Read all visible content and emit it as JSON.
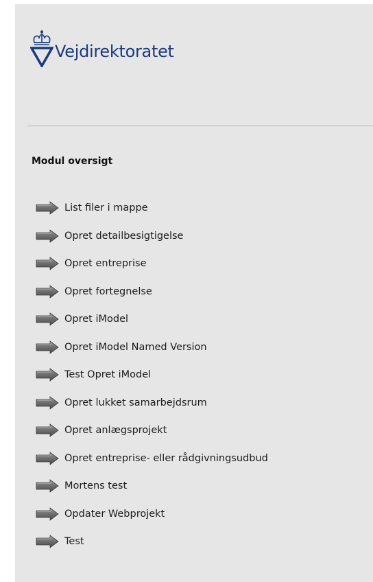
{
  "header": {
    "logo_text": "Vejdirektoratet",
    "logo_icon": "crown-triangle-logo"
  },
  "section": {
    "title": "Modul oversigt"
  },
  "menu": {
    "icon": "arrow-right-icon",
    "items": [
      {
        "label": "List filer i mappe"
      },
      {
        "label": "Opret detailbesigtigelse"
      },
      {
        "label": "Opret entreprise"
      },
      {
        "label": "Opret fortegnelse"
      },
      {
        "label": "Opret iModel"
      },
      {
        "label": "Opret iModel Named Version"
      },
      {
        "label": "Test Opret iModel"
      },
      {
        "label": "Opret lukket samarbejdsrum"
      },
      {
        "label": "Opret anlægsprojekt"
      },
      {
        "label": "Opret entreprise- eller rådgivningsudbud"
      },
      {
        "label": "Mortens test"
      },
      {
        "label": "Opdater Webprojekt"
      },
      {
        "label": "Test"
      }
    ]
  },
  "colors": {
    "background": "#e6e6e6",
    "brand_blue": "#1a3a7c",
    "divider": "#b4b4b4"
  }
}
